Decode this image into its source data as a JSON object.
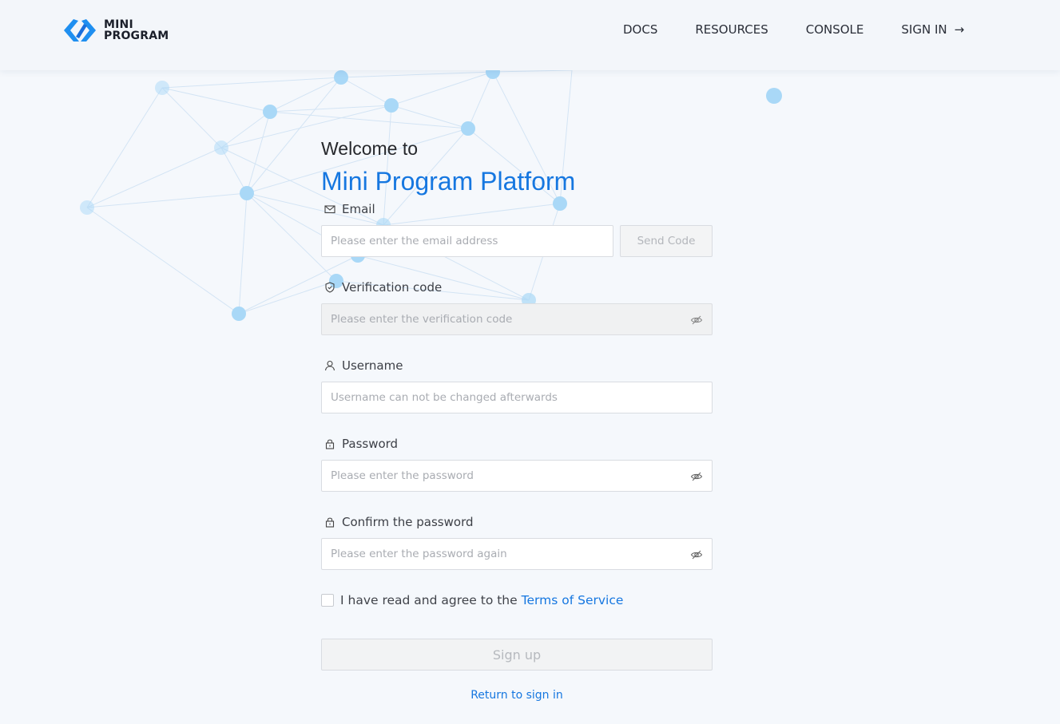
{
  "header": {
    "logo": {
      "line1": "MINI",
      "line2": "PROGRAM",
      "icon": "mini-program-logo-icon"
    },
    "nav": [
      {
        "label": "DOCS"
      },
      {
        "label": "RESOURCES"
      },
      {
        "label": "CONSOLE"
      },
      {
        "label": "SIGN IN",
        "icon": "arrow-right-icon"
      }
    ]
  },
  "form": {
    "welcome": "Welcome to",
    "platform": "Mini Program Platform",
    "email": {
      "label": "Email",
      "icon": "mail-icon",
      "placeholder": "Please enter the email address",
      "send_code": "Send Code"
    },
    "verification": {
      "label": "Verification code",
      "icon": "shield-check-icon",
      "placeholder": "Please enter the verification code"
    },
    "username": {
      "label": "Username",
      "icon": "user-icon",
      "placeholder": "Username can not be changed afterwards"
    },
    "password": {
      "label": "Password",
      "icon": "lock-icon",
      "placeholder": "Please enter the password"
    },
    "confirm": {
      "label": "Confirm the password",
      "icon": "lock-icon",
      "placeholder": "Please enter the password again"
    },
    "agree_text": "I have read and agree to the",
    "terms_link": "Terms of Service",
    "signup_button": "Sign up",
    "return_link": "Return to sign in"
  },
  "colors": {
    "accent": "#1677e0",
    "background": "#f5f8fc",
    "node": "#a9d8f7"
  }
}
